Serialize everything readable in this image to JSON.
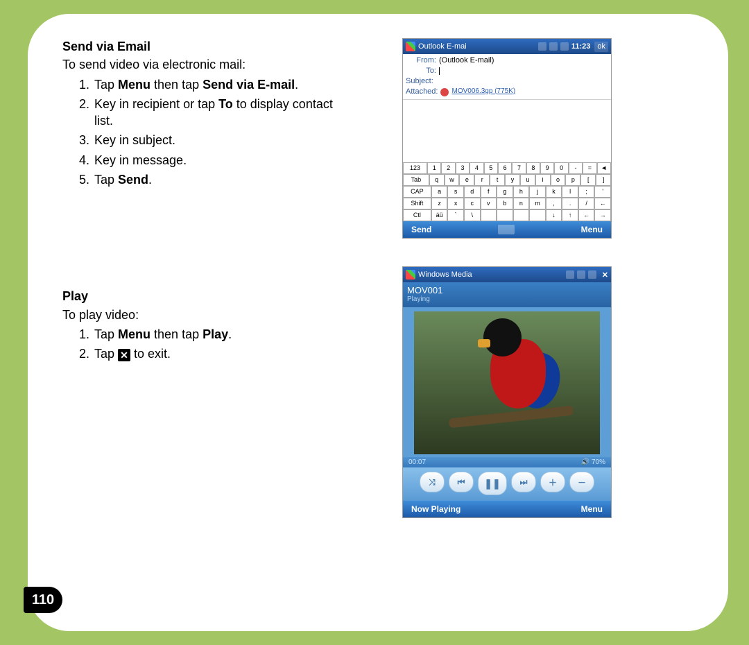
{
  "page_number": "110",
  "section1": {
    "title": "Send via Email",
    "intro": "To send video via electronic mail:",
    "step1_pre": "Tap ",
    "step1_b1": "Menu",
    "step1_mid": " then tap ",
    "step1_b2": "Send via E-mail",
    "step1_end": ".",
    "step2_pre": "Key in recipient or tap ",
    "step2_b": "To",
    "step2_end": " to display contact list.",
    "step3": "Key in subject.",
    "step4": "Key in message.",
    "step5_pre": "Tap ",
    "step5_b": "Send",
    "step5_end": "."
  },
  "section2": {
    "title": "Play",
    "intro": "To play video:",
    "step1_pre": "Tap ",
    "step1_b1": "Menu",
    "step1_mid": " then tap ",
    "step1_b2": "Play",
    "step1_end": ".",
    "step2_pre": "Tap ",
    "step2_end": " to exit."
  },
  "phone_email": {
    "app_title": "Outlook E-mai",
    "time": "11:23",
    "ok": "ok",
    "from_label": "From:",
    "from_value": "(Outlook E-mail)",
    "to_label": "To:",
    "subject_label": "Subject:",
    "attached_label": "Attached:",
    "attachment": "MOV006.3gp (775K)",
    "kb": {
      "r1": [
        "123",
        "1",
        "2",
        "3",
        "4",
        "5",
        "6",
        "7",
        "8",
        "9",
        "0",
        "-",
        "=",
        "◄"
      ],
      "r2": [
        "Tab",
        "q",
        "w",
        "e",
        "r",
        "t",
        "y",
        "u",
        "i",
        "o",
        "p",
        "[",
        "]"
      ],
      "r3": [
        "CAP",
        "a",
        "s",
        "d",
        "f",
        "g",
        "h",
        "j",
        "k",
        "l",
        ";",
        "'"
      ],
      "r4": [
        "Shift",
        "z",
        "x",
        "c",
        "v",
        "b",
        "n",
        "m",
        ",",
        ".",
        "/",
        "←"
      ],
      "r5": [
        "Ctl",
        "áü",
        "`",
        "\\",
        " ",
        " ",
        " ",
        " ",
        "↓",
        "↑",
        "←",
        "→"
      ]
    },
    "send": "Send",
    "menu": "Menu"
  },
  "phone_media": {
    "app_title": "Windows Media",
    "video_name": "MOV001",
    "status": "Playing",
    "elapsed": "00:07",
    "volume": "70%",
    "now_playing": "Now Playing",
    "menu": "Menu"
  }
}
